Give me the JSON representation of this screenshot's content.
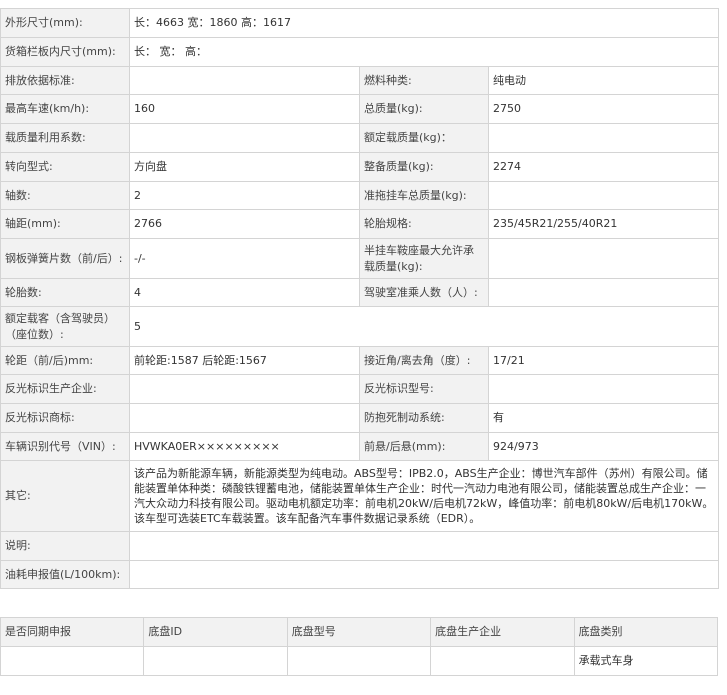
{
  "spec": {
    "dimensions": {
      "label": "外形尺寸(mm):",
      "value": "长：4663 宽：1860 高：1617"
    },
    "cargo_box": {
      "label": "货箱栏板内尺寸(mm):",
      "value": "长： 宽： 高："
    },
    "emission_standard": {
      "label": "排放依据标准:",
      "value": ""
    },
    "fuel_type": {
      "label": "燃料种类:",
      "value": "纯电动"
    },
    "max_speed": {
      "label": "最高车速(km/h):",
      "value": "160"
    },
    "gross_mass": {
      "label": "总质量(kg):",
      "value": "2750"
    },
    "load_utilization": {
      "label": "载质量利用系数:",
      "value": ""
    },
    "rated_load": {
      "label": "额定载质量(kg)：",
      "value": ""
    },
    "steering": {
      "label": "转向型式:",
      "value": "方向盘"
    },
    "curb_mass": {
      "label": "整备质量(kg):",
      "value": "2274"
    },
    "axles": {
      "label": "轴数:",
      "value": "2"
    },
    "trailer_mass": {
      "label": "准拖挂车总质量(kg):",
      "value": ""
    },
    "wheelbase": {
      "label": "轴距(mm):",
      "value": "2766"
    },
    "tire_spec": {
      "label": "轮胎规格:",
      "value": "235/45R21/255/40R21"
    },
    "leaf_springs": {
      "label": "钢板弹簧片数（前/后）:",
      "value": "-/-"
    },
    "saddle_load": {
      "label": "半挂车鞍座最大允许承载质量(kg):",
      "value": ""
    },
    "tire_count": {
      "label": "轮胎数:",
      "value": "4"
    },
    "cab_seats": {
      "label": "驾驶室准乘人数（人）:",
      "value": ""
    },
    "passengers": {
      "label": "额定载客（含驾驶员）（座位数）:",
      "value": "5"
    },
    "track": {
      "label": "轮距（前/后)mm:",
      "value": "前轮距:1587 后轮距:1567"
    },
    "angles": {
      "label": "接近角/离去角（度）:",
      "value": "17/21"
    },
    "reflector_maker": {
      "label": "反光标识生产企业:",
      "value": ""
    },
    "reflector_model": {
      "label": "反光标识型号:",
      "value": ""
    },
    "reflector_brand": {
      "label": "反光标识商标:",
      "value": ""
    },
    "abs": {
      "label": "防抱死制动系统:",
      "value": "有"
    },
    "vin": {
      "label": "车辆识别代号（VIN）:",
      "value": "HVWKA0ER×××××××××"
    },
    "overhang": {
      "label": "前悬/后悬(mm):",
      "value": "924/973"
    },
    "other": {
      "label": "其它:",
      "value": "该产品为新能源车辆，新能源类型为纯电动。ABS型号：IPB2.0，ABS生产企业：博世汽车部件（苏州）有限公司。储能装置单体种类：磷酸铁锂蓄电池，储能装置单体生产企业：时代一汽动力电池有限公司，储能装置总成生产企业：一汽大众动力科技有限公司。驱动电机额定功率：前电机20kW/后电机72kW，峰值功率：前电机80kW/后电机170kW。该车型可选装ETC车载装置。该车配备汽车事件数据记录系统（EDR）。"
    },
    "note": {
      "label": "说明:",
      "value": ""
    },
    "fuel_consumption": {
      "label": "油耗申报值(L/100km):",
      "value": ""
    }
  },
  "chassis": {
    "headers": [
      "是否同期申报",
      "底盘ID",
      "底盘型号",
      "底盘生产企业",
      "底盘类别"
    ],
    "row": [
      "",
      "",
      "",
      "",
      "承载式车身"
    ]
  }
}
